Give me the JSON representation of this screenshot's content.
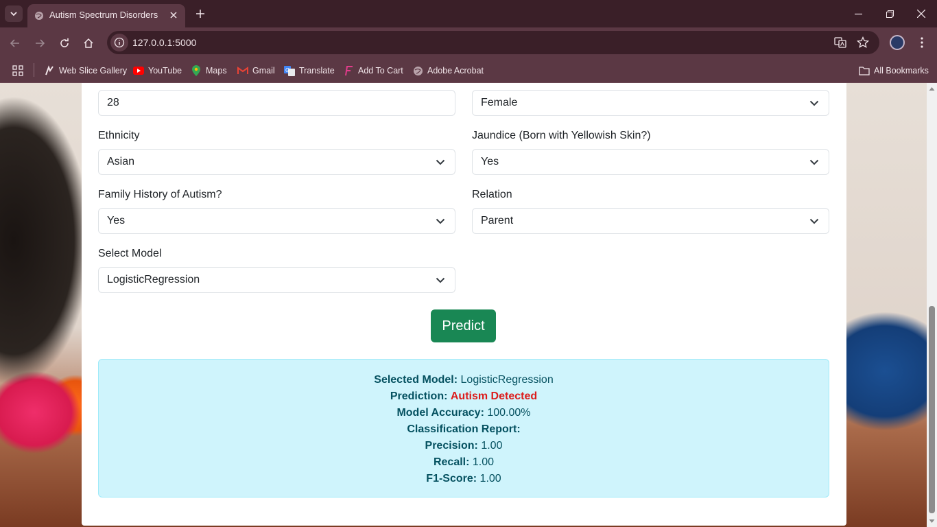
{
  "browser": {
    "tab_title": "Autism Spectrum Disorders",
    "url": "127.0.0.1:5000",
    "bookmarks": [
      "Web Slice Gallery",
      "YouTube",
      "Maps",
      "Gmail",
      "Translate",
      "Add To Cart",
      "Adobe Acrobat"
    ],
    "all_bookmarks": "All Bookmarks"
  },
  "form": {
    "age_value": "28",
    "gender_value": "Female",
    "ethnicity_label": "Ethnicity",
    "ethnicity_value": "Asian",
    "jaundice_label": "Jaundice (Born with Yellowish Skin?)",
    "jaundice_value": "Yes",
    "family_label": "Family History of Autism?",
    "family_value": "Yes",
    "relation_label": "Relation",
    "relation_value": "Parent",
    "model_label": "Select Model",
    "model_value": "LogisticRegression",
    "predict_label": "Predict"
  },
  "result": {
    "selected_model_label": "Selected Model:",
    "selected_model_value": "LogisticRegression",
    "prediction_label": "Prediction:",
    "prediction_value": "Autism Detected",
    "accuracy_label": "Model Accuracy:",
    "accuracy_value": "100.00%",
    "report_label": "Classification Report:",
    "precision_label": "Precision:",
    "precision_value": "1.00",
    "recall_label": "Recall:",
    "recall_value": "1.00",
    "f1_label": "F1-Score:",
    "f1_value": "1.00"
  },
  "colors": {
    "predict_button": "#198754",
    "result_background": "#cff4fc",
    "result_text": "#055160",
    "detected_text": "#dc1c1c"
  }
}
